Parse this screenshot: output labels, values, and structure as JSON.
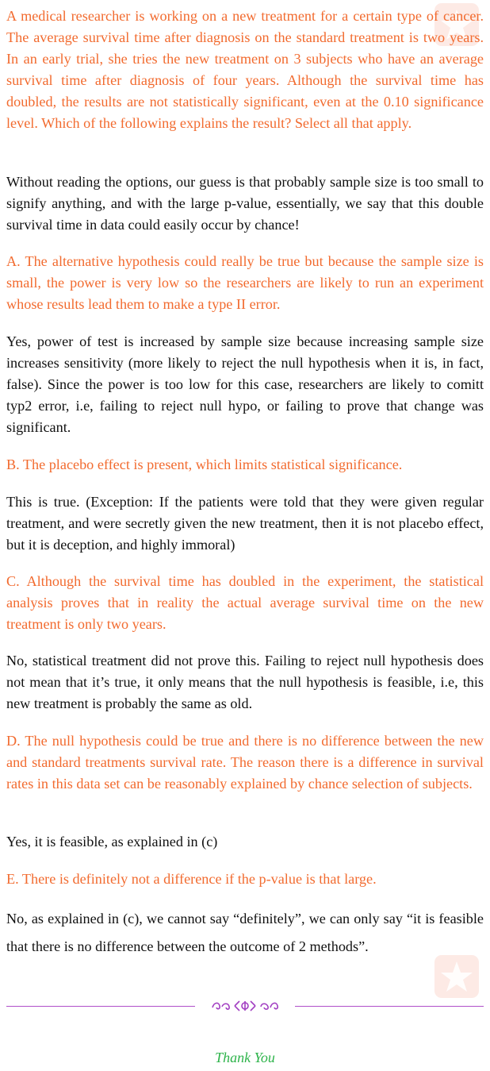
{
  "question": {
    "intro": "A medical researcher is working on a new treatment for a certain type of cancer.  The average survival time after diagnosis on the standard treatment is two years. In an early trial, she tries the new treatment on 3 subjects who have an average survival time after diagnosis of four years. Although the survival time has doubled, the results are not statistically significant, even at the 0.10 significance level.  Which of the following explains the result? Select all that apply."
  },
  "initial_guess": "Without reading the options, our guess is that probably sample size is too small to signify anything, and with the large p-value, essentially, we say that this double survival time in data could easily occur by chance!",
  "options": [
    {
      "text": "A. The alternative hypothesis could really be true but because the sample size is small, the power is very low so the researchers are likely to run an experiment whose results lead them to make a type II error.",
      "answer": "Yes, power of test is increased by sample size because increasing sample size increases sensitivity (more likely to reject the null hypothesis when it is, in fact, false). Since the power is too low for this case, researchers are likely to comitt typ2 error, i.e, failing to reject null hypo, or failing to prove that change was significant."
    },
    {
      "text": "B. The placebo effect is present, which limits statistical significance.",
      "answer": "This is true.  (Exception: If the patients were told that they were given regular treatment, and were secretly given the new treatment, then it is not placebo effect, but it is deception, and highly immoral)"
    },
    {
      "text": "C. Although the survival time has doubled in the experiment, the statistical analysis proves that in reality the actual average survival time on the new treatment is only two years.",
      "answer": "No, statistical treatment did not prove this. Failing to reject null hypothesis does not mean that it’s true, it only means that the null hypothesis is feasible, i.e, this new treatment is probably the same as old."
    },
    {
      "text": "D. The null hypothesis could be true and there is no difference between the new and standard treatments survival rate.  The reason there is a difference in survival rates in this data set can be reasonably explained by chance selection of subjects.",
      "answer": "Yes, it is feasible, as explained in (c)"
    },
    {
      "text": "E. There is definitely not a difference if the p-value is that large.",
      "answer": "No, as explained in (c), we cannot say “definitely”, we can only say “it is feasible that there is no difference between the outcome of 2 methods”."
    }
  ],
  "footer": {
    "thanks": "Thank You"
  },
  "colors": {
    "question": "#f26b2f",
    "answer": "#111111",
    "rule": "#b04fc9",
    "thanks": "#2db34a",
    "watermark": "#fde7e1"
  },
  "icons": {
    "watermark": "star-badge-icon",
    "divider": "floral-ornament-icon"
  }
}
